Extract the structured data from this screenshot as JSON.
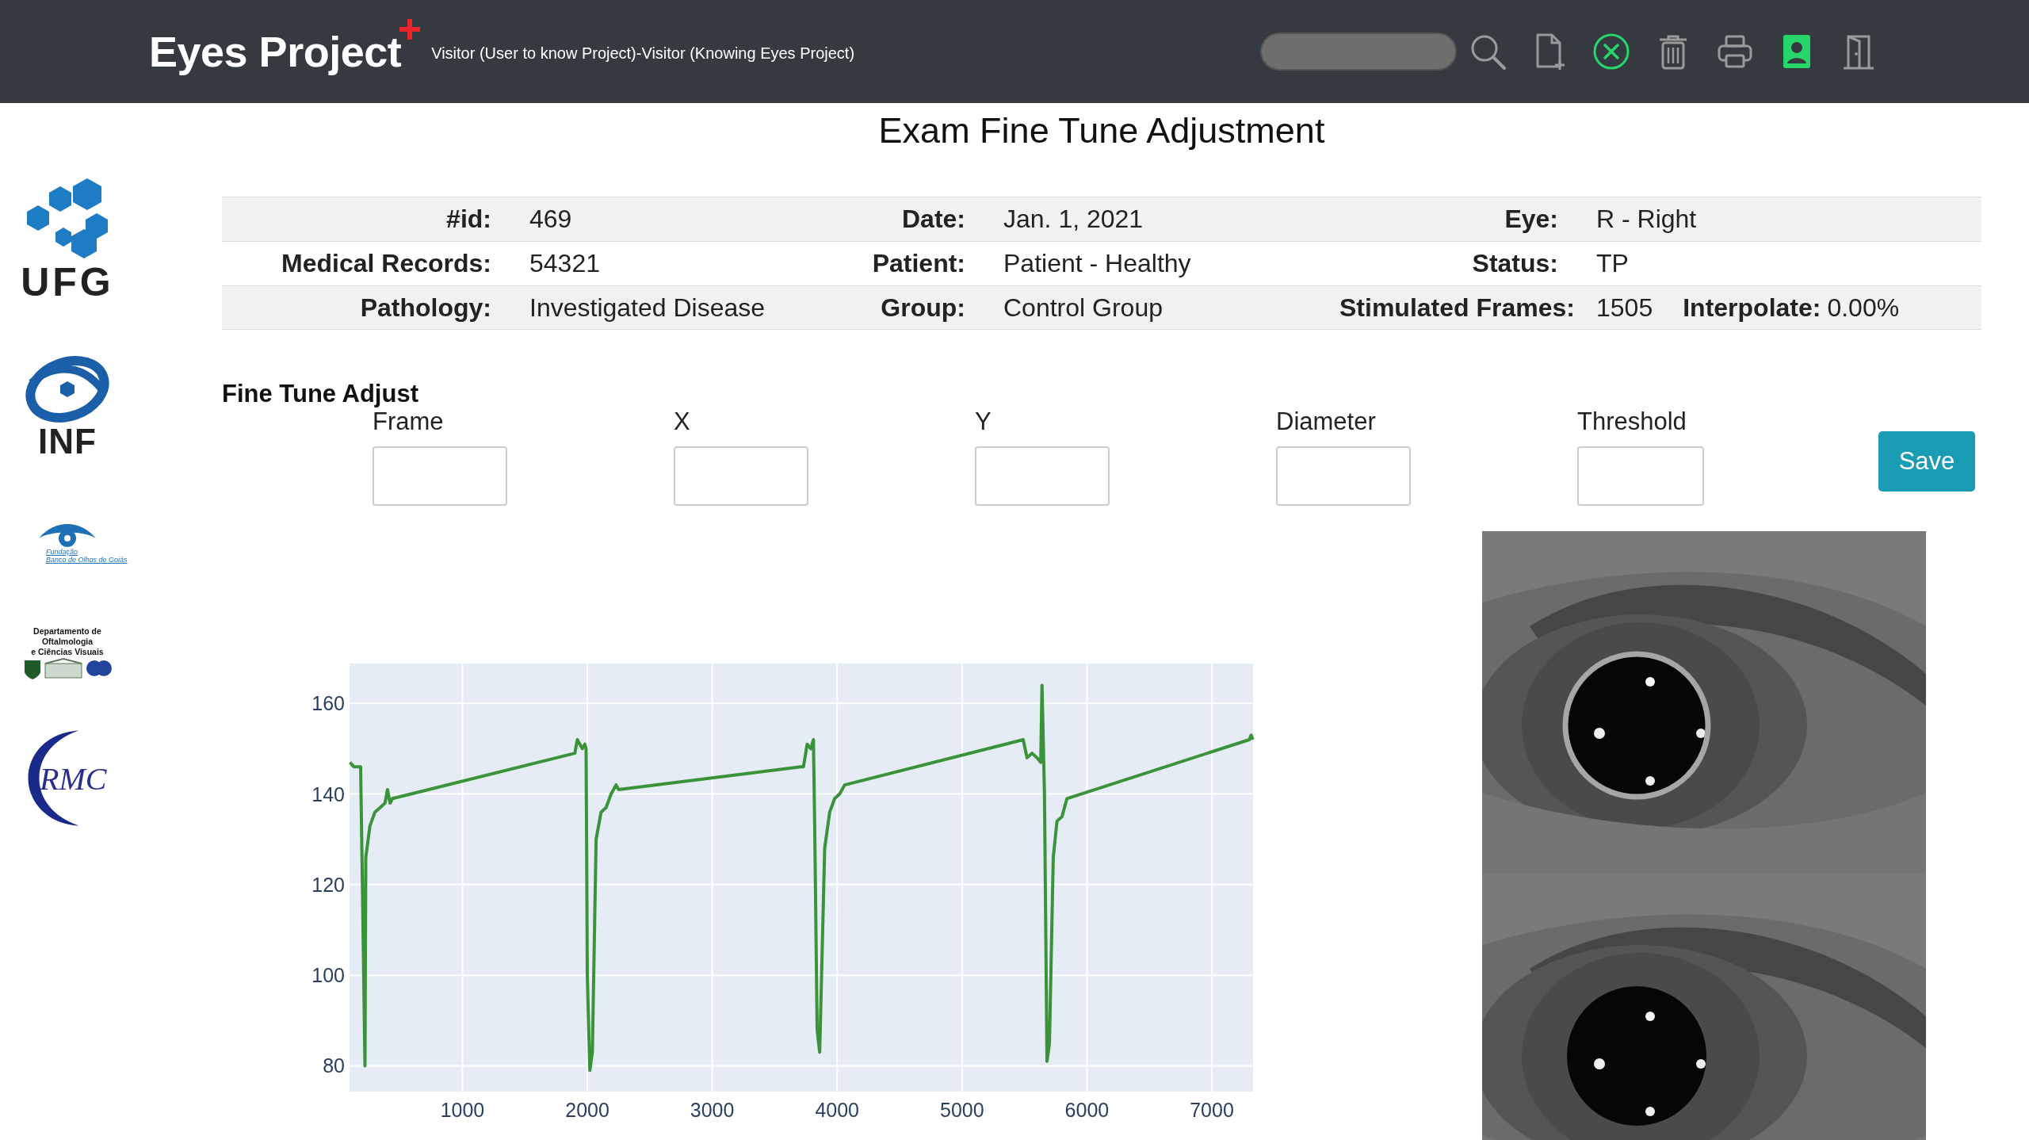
{
  "header": {
    "brand": "Eyes Project",
    "user": "Visitor (User to know Project)-Visitor (Knowing Eyes Project)"
  },
  "title": "Exam Fine Tune Adjustment",
  "logos": [
    {
      "kind": "ufg",
      "lines": [
        "UFG"
      ]
    },
    {
      "kind": "inf",
      "lines": [
        "INF"
      ]
    },
    {
      "kind": "fundacao",
      "lines": [
        "Fundação",
        "Banco de Olhos de Goiás"
      ]
    },
    {
      "kind": "dept",
      "lines": [
        "Departamento de",
        "Oftalmologia",
        "e Ciências Visuais"
      ]
    },
    {
      "kind": "rmc",
      "lines": [
        "RMC"
      ]
    }
  ],
  "exam_info": {
    "rows": [
      [
        {
          "label": "#id:",
          "value": "469"
        },
        {
          "label": "Date:",
          "value": "Jan. 1, 2021"
        },
        {
          "label": "Eye:",
          "value": "R - Right"
        }
      ],
      [
        {
          "label": "Medical Records:",
          "value": "54321"
        },
        {
          "label": "Patient:",
          "value": "Patient - Healthy"
        },
        {
          "label": "Status:",
          "value": "TP"
        }
      ],
      [
        {
          "label": "Pathology:",
          "value": "Investigated Disease"
        },
        {
          "label": "Group:",
          "value": "Control Group"
        },
        {
          "label": "Stimulated Frames:",
          "value": "1505"
        },
        {
          "label": "Interpolate:",
          "value": "0.00%"
        }
      ]
    ]
  },
  "fine_tune": {
    "title": "Fine Tune Adjust",
    "fields": [
      {
        "label": "Frame"
      },
      {
        "label": "X"
      },
      {
        "label": "Y"
      },
      {
        "label": "Diameter"
      },
      {
        "label": "Threshold"
      }
    ],
    "save": "Save"
  },
  "chart": {
    "chart_data": {
      "type": "line",
      "grid": true,
      "xlim": [
        96,
        7330
      ],
      "ylim": [
        74.3,
        168.8
      ],
      "xticks": [
        1000,
        2000,
        3000,
        4000,
        5000,
        6000,
        7000
      ],
      "yticks": [
        80,
        100,
        120,
        140,
        160
      ],
      "x": [
        100,
        130,
        180,
        185,
        200,
        220,
        226,
        260,
        300,
        340,
        380,
        400,
        420,
        440,
        1900,
        1920,
        1960,
        1980,
        1990,
        2000,
        2020,
        2040,
        2070,
        2110,
        2150,
        2190,
        2230,
        2250,
        3710,
        3730,
        3760,
        3790,
        3810,
        3820,
        3840,
        3860,
        3900,
        3940,
        3980,
        4020,
        4060,
        5490,
        5520,
        5560,
        5600,
        5630,
        5640,
        5660,
        5680,
        5700,
        5730,
        5760,
        5800,
        5840,
        7300,
        7315,
        7328
      ],
      "series": [
        {
          "color": "#3a9339",
          "values": [
            147,
            146,
            146,
            146,
            118,
            80,
            126,
            133,
            136,
            137,
            138,
            141,
            138,
            139,
            149,
            152,
            150,
            151,
            150,
            100,
            79,
            83,
            130,
            136,
            137,
            140,
            142,
            141,
            146,
            146,
            151,
            150,
            152,
            133,
            88,
            83,
            128,
            136,
            139,
            140,
            142,
            152,
            148,
            149,
            148,
            147,
            164,
            140,
            81,
            85,
            126,
            134,
            135,
            139,
            152,
            153,
            152
          ]
        }
      ]
    }
  }
}
